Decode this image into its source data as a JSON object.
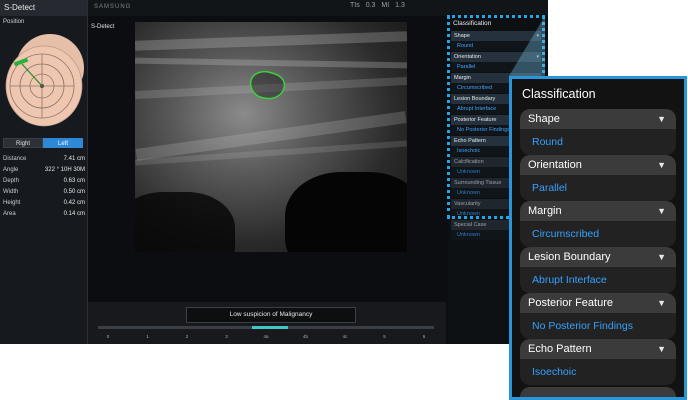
{
  "left_panel": {
    "title": "S-Detect",
    "position_label": "Position",
    "side_buttons": [
      "Right",
      "Left"
    ],
    "selected_side": "Left",
    "measurements": [
      {
        "label": "Distance",
        "value": "7.41 cm"
      },
      {
        "label": "Angle",
        "value": "322 ° 10H 30M"
      },
      {
        "label": "Depth",
        "value": "0.63 cm"
      },
      {
        "label": "Width",
        "value": "0.50 cm"
      },
      {
        "label": "Height",
        "value": "0.42 cm"
      },
      {
        "label": "Area",
        "value": "0.14 cm"
      }
    ]
  },
  "top_bar": {
    "brand": "SAMSUNG",
    "tis_label": "TIs",
    "tis_value": "0.3",
    "mi_label": "MI",
    "mi_value": "1.3"
  },
  "image_area": {
    "mode_label": "S-Detect"
  },
  "bottom_bar": {
    "message": "Low suspicion of Malignancy",
    "scale_ticks": [
      "0",
      "1",
      "2",
      "3",
      "4a",
      "4b",
      "4c",
      "5",
      "6"
    ],
    "scale_marker_value": "4a"
  },
  "classification_panel": {
    "title": "Classification",
    "items": [
      {
        "label": "Shape",
        "value": "Round"
      },
      {
        "label": "Orientation",
        "value": "Parallel"
      },
      {
        "label": "Margin",
        "value": "Circumscribed"
      },
      {
        "label": "Lesion Boundary",
        "value": "Abrupt Interface"
      },
      {
        "label": "Posterior Feature",
        "value": "No Posterior Findings"
      },
      {
        "label": "Echo Pattern",
        "value": "Isoechoic"
      },
      {
        "label": "Calcification",
        "value": "Unknown"
      },
      {
        "label": "Surrounding Tissue",
        "value": "Unknown"
      },
      {
        "label": "Vascularity",
        "value": "Unknown"
      },
      {
        "label": "Special Case",
        "value": "Unknown"
      }
    ]
  },
  "zoom_panel": {
    "title": "Classification",
    "items": [
      {
        "label": "Shape",
        "value": "Round"
      },
      {
        "label": "Orientation",
        "value": "Parallel"
      },
      {
        "label": "Margin",
        "value": "Circumscribed"
      },
      {
        "label": "Lesion Boundary",
        "value": "Abrupt Interface"
      },
      {
        "label": "Posterior Feature",
        "value": "No Posterior Findings"
      },
      {
        "label": "Echo Pattern",
        "value": "Isoechoic"
      }
    ]
  },
  "colors": {
    "accent_blue": "#2a95db",
    "value_blue": "#36a1ff",
    "lesion_outline": "#3bd23b",
    "scale_marker": "#3ec7c7"
  }
}
